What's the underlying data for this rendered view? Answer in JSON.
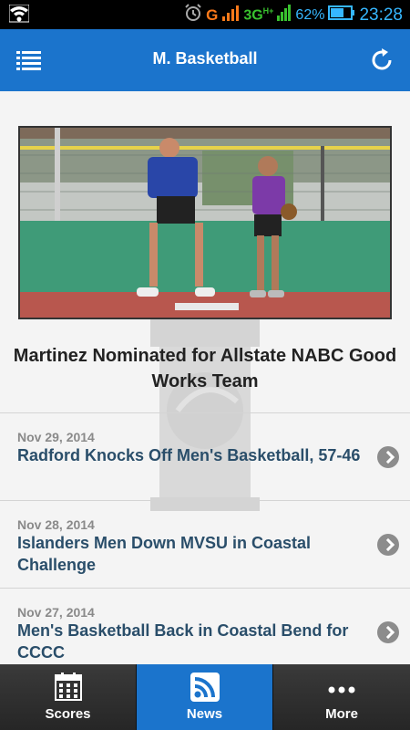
{
  "status_bar": {
    "network_g": "G",
    "network_3g": "3G",
    "network_sub": "H+",
    "battery": "62%",
    "time": "23:28",
    "icons": [
      "wifi-icon",
      "alarm-icon",
      "signal-icon",
      "battery-icon"
    ]
  },
  "app_bar": {
    "title": "M. Basketball",
    "menu_icon": "menu-icon",
    "refresh_icon": "refresh-icon",
    "color": "#1b74cc"
  },
  "featured": {
    "title": "Martinez Nominated for Allstate NABC Good Works Team"
  },
  "news": [
    {
      "date": "Nov 29, 2014",
      "headline": "Radford Knocks Off Men's Basketball, 57-46"
    },
    {
      "date": "Nov 28, 2014",
      "headline": "Islanders Men Down MVSU in Coastal Challenge"
    },
    {
      "date": "Nov 27, 2014",
      "headline": "Men's Basketball Back in Coastal Bend for CCCC"
    }
  ],
  "tabs": [
    {
      "label": "Scores",
      "icon": "calendar-icon",
      "active": false
    },
    {
      "label": "News",
      "icon": "rss-icon",
      "active": true
    },
    {
      "label": "More",
      "icon": "more-icon",
      "active": false
    }
  ]
}
